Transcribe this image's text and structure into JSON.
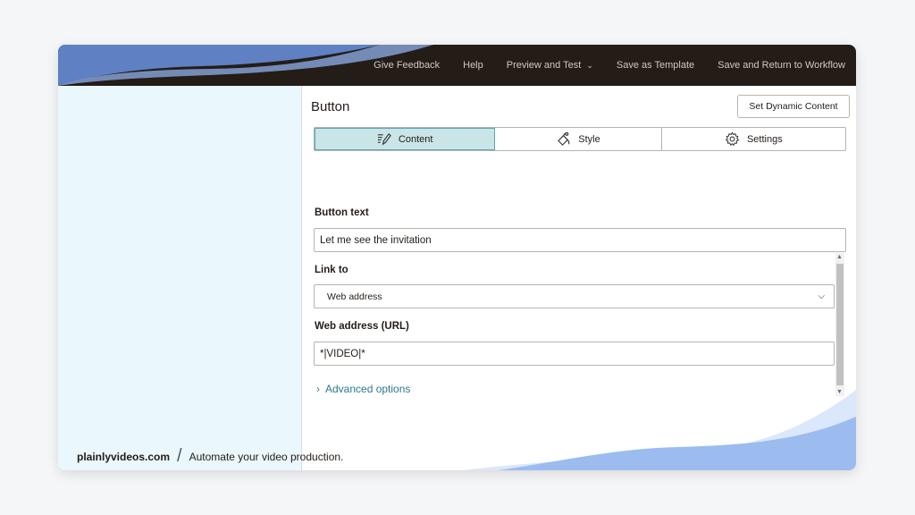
{
  "nav": {
    "give_feedback": "Give Feedback",
    "help": "Help",
    "preview_and_test": "Preview and Test",
    "save_as_template": "Save as Template",
    "save_and_return": "Save and Return to Workflow"
  },
  "panel": {
    "title": "Button",
    "dynamic_content_button": "Set Dynamic Content",
    "tabs": [
      {
        "label": "Content",
        "icon": "pencil-icon",
        "active": true
      },
      {
        "label": "Style",
        "icon": "paint-bucket-icon",
        "active": false
      },
      {
        "label": "Settings",
        "icon": "gear-icon",
        "active": false
      }
    ],
    "button_text_label": "Button text",
    "button_text_value": "Let me see the invitation",
    "link_to_label": "Link to",
    "link_to_value": "Web address",
    "url_label": "Web address (URL)",
    "url_value": "*|VIDEO|*",
    "advanced_options": "Advanced options"
  },
  "footer": {
    "brand": "plainlyvideos.com",
    "tagline": "Automate your video production."
  },
  "colors": {
    "topbar": "#241c17",
    "sidebar": "#eaf7fd",
    "active_tab": "#c9e5e7",
    "link": "#2b7a8c",
    "wave_blue": "#8fb0ec"
  }
}
